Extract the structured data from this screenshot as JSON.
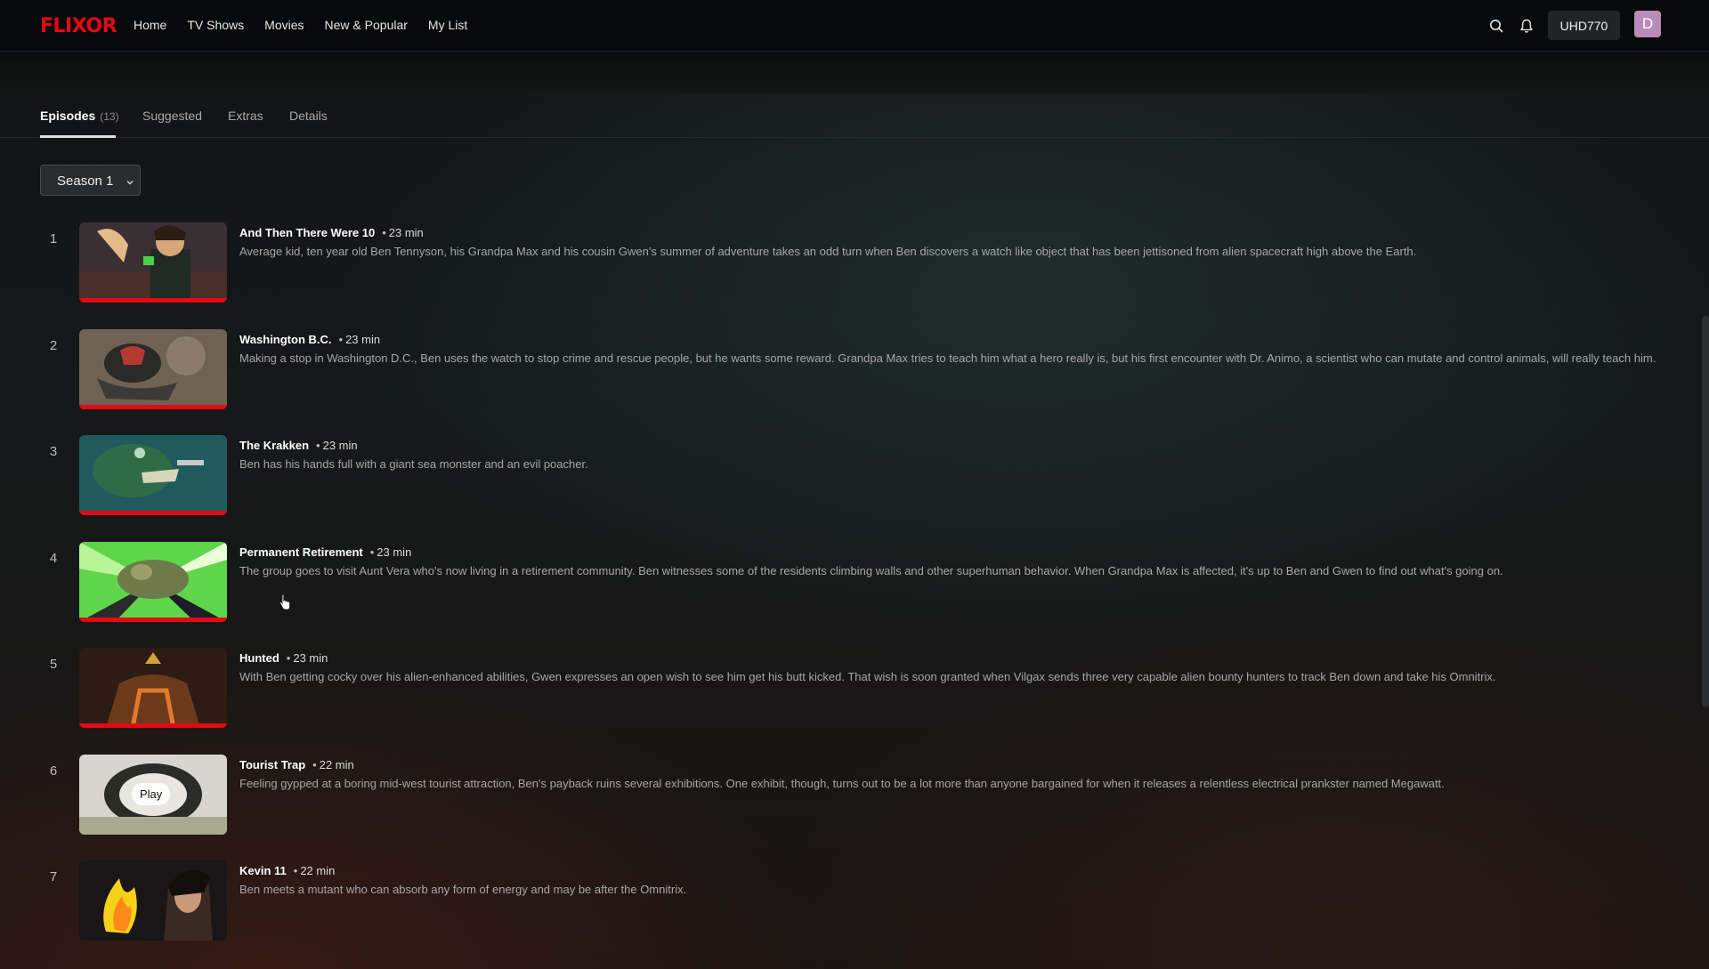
{
  "brand": "FLIXOR",
  "nav": [
    "Home",
    "TV Shows",
    "Movies",
    "New & Popular",
    "My List"
  ],
  "header": {
    "plan_badge": "UHD770",
    "avatar_letter": "D"
  },
  "tabs": [
    {
      "label": "Episodes",
      "count": "(13)",
      "active": true
    },
    {
      "label": "Suggested"
    },
    {
      "label": "Extras"
    },
    {
      "label": "Details"
    }
  ],
  "season_select": {
    "value": "Season 1"
  },
  "episodes": [
    {
      "number": "1",
      "title": "And Then There Were 10",
      "duration": "23 min",
      "watched_fraction": 1.0,
      "description": "Average kid, ten year old Ben Tennyson, his Grandpa Max and his cousin Gwen's summer of adventure takes an odd turn when Ben discovers a watch like object that has been jettisoned from alien spacecraft high above the Earth."
    },
    {
      "number": "2",
      "title": "Washington B.C.",
      "duration": "23 min",
      "watched_fraction": 1.0,
      "description": "Making a stop in Washington D.C., Ben uses the watch to stop crime and rescue people, but he wants some reward. Grandpa Max tries to teach him what a hero really is, but his first encounter with Dr. Animo, a scientist who can mutate and control animals, will really teach him."
    },
    {
      "number": "3",
      "title": "The Krakken",
      "duration": "23 min",
      "watched_fraction": 1.0,
      "description": "Ben has his hands full with a giant sea monster and an evil poacher."
    },
    {
      "number": "4",
      "title": "Permanent Retirement",
      "duration": "23 min",
      "watched_fraction": 1.0,
      "description": "The group goes to visit Aunt Vera who's now living in a retirement community. Ben witnesses some of the residents climbing walls and other superhuman behavior. When Grandpa Max is affected, it's up to Ben and Gwen to find out what's going on."
    },
    {
      "number": "5",
      "title": "Hunted",
      "duration": "23 min",
      "watched_fraction": 1.0,
      "description": "With Ben getting cocky over his alien-enhanced abilities, Gwen expresses an open wish to see him get his butt kicked. That wish is soon granted when Vilgax sends three very capable alien bounty hunters to track Ben down and take his Omnitrix."
    },
    {
      "number": "6",
      "title": "Tourist Trap",
      "duration": "22 min",
      "watched_fraction": 0,
      "play_label": "Play",
      "description": "Feeling gypped at a boring mid-west tourist attraction, Ben's payback ruins several exhibitions. One exhibit, though, turns out to be a lot more than anyone bargained for when it releases a relentless electrical prankster named Megawatt."
    },
    {
      "number": "7",
      "title": "Kevin 11",
      "duration": "22 min",
      "watched_fraction": 0,
      "description": "Ben meets a mutant who can absorb any form of energy and may be after the Omnitrix."
    }
  ],
  "colors": {
    "brand": "#e50914",
    "progress": "#e50914",
    "avatar": "#b98bb9"
  },
  "icons": [
    "search-icon",
    "bell-icon",
    "chevron-down-icon",
    "pointer-cursor-icon"
  ]
}
